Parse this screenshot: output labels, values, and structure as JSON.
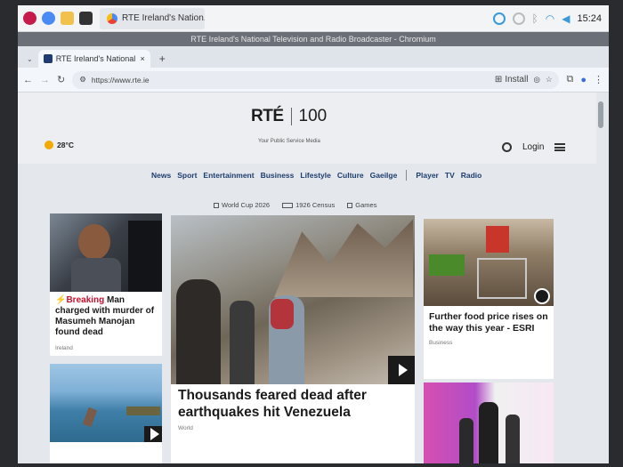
{
  "taskbar": {
    "window_task": "RTE Ireland's Nation...",
    "clock": "15:24"
  },
  "window_title": "RTE Ireland's National Television and Radio Broadcaster - Chromium",
  "tabs": [
    {
      "label": "RTE Ireland's National"
    }
  ],
  "omnibox": {
    "url": "https://www.rte.ie",
    "install_label": "Install"
  },
  "site": {
    "logo_rte": "RTÉ",
    "logo_100": "100",
    "tagline": "Your Public Service Media",
    "weather_temp": "28°C",
    "login": "Login",
    "nav": [
      "News",
      "Sport",
      "Entertainment",
      "Business",
      "Lifestyle",
      "Culture",
      "Gaeilge"
    ],
    "nav_right": [
      "Player",
      "TV",
      "Radio"
    ],
    "subnav": [
      "World Cup 2026",
      "1926 Census",
      "Games"
    ]
  },
  "stories": {
    "left_top": {
      "breaking": "Breaking",
      "headline": "Man charged with murder of Masumeh Manojan found dead",
      "section": "Ireland"
    },
    "center": {
      "headline": "Thousands feared dead after earthquakes hit Venezuela",
      "section": "World"
    },
    "right_top": {
      "headline": "Further food price rises on the way this year - ESRI",
      "section": "Business"
    }
  },
  "colors": {
    "brand_navy": "#1d3d6e",
    "breaking_red": "#c8102e"
  }
}
